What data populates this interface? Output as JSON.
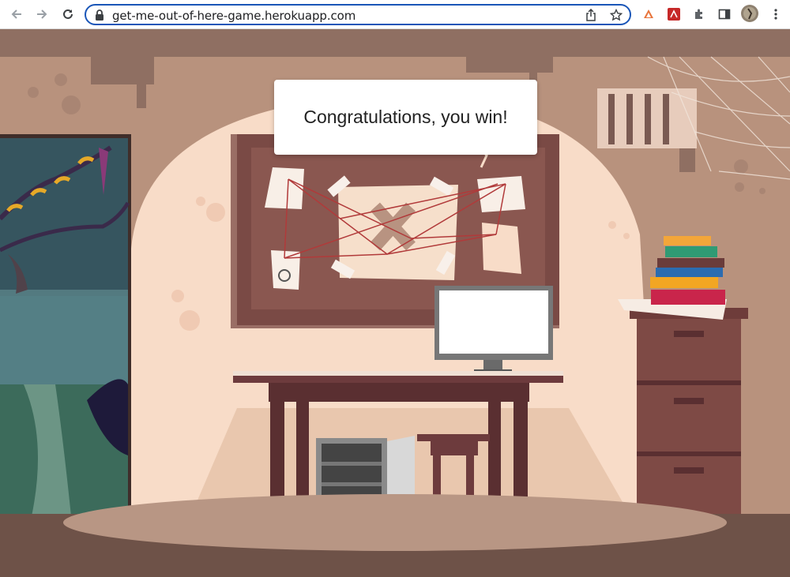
{
  "browser": {
    "url": "get-me-out-of-here-game.herokuapp.com",
    "back_icon": "arrow-left-icon",
    "forward_icon": "arrow-right-icon",
    "reload_icon": "reload-icon",
    "lock_icon": "lock-icon",
    "share_icon": "share-icon",
    "bookmark_icon": "star-icon",
    "extensions": [
      "triangle-extension-icon",
      "red-extension-icon",
      "puzzle-icon",
      "sidepanel-icon",
      "avatar",
      "menu-dots-icon"
    ]
  },
  "game": {
    "message": "Congratulations, you win!",
    "colors": {
      "wall": "#f8dcc8",
      "wall_dark": "#b88e78",
      "ceiling": "#8f6f62",
      "board": "#7a4a45",
      "floor": "#6e5248",
      "desk": "#5a2f31"
    }
  }
}
